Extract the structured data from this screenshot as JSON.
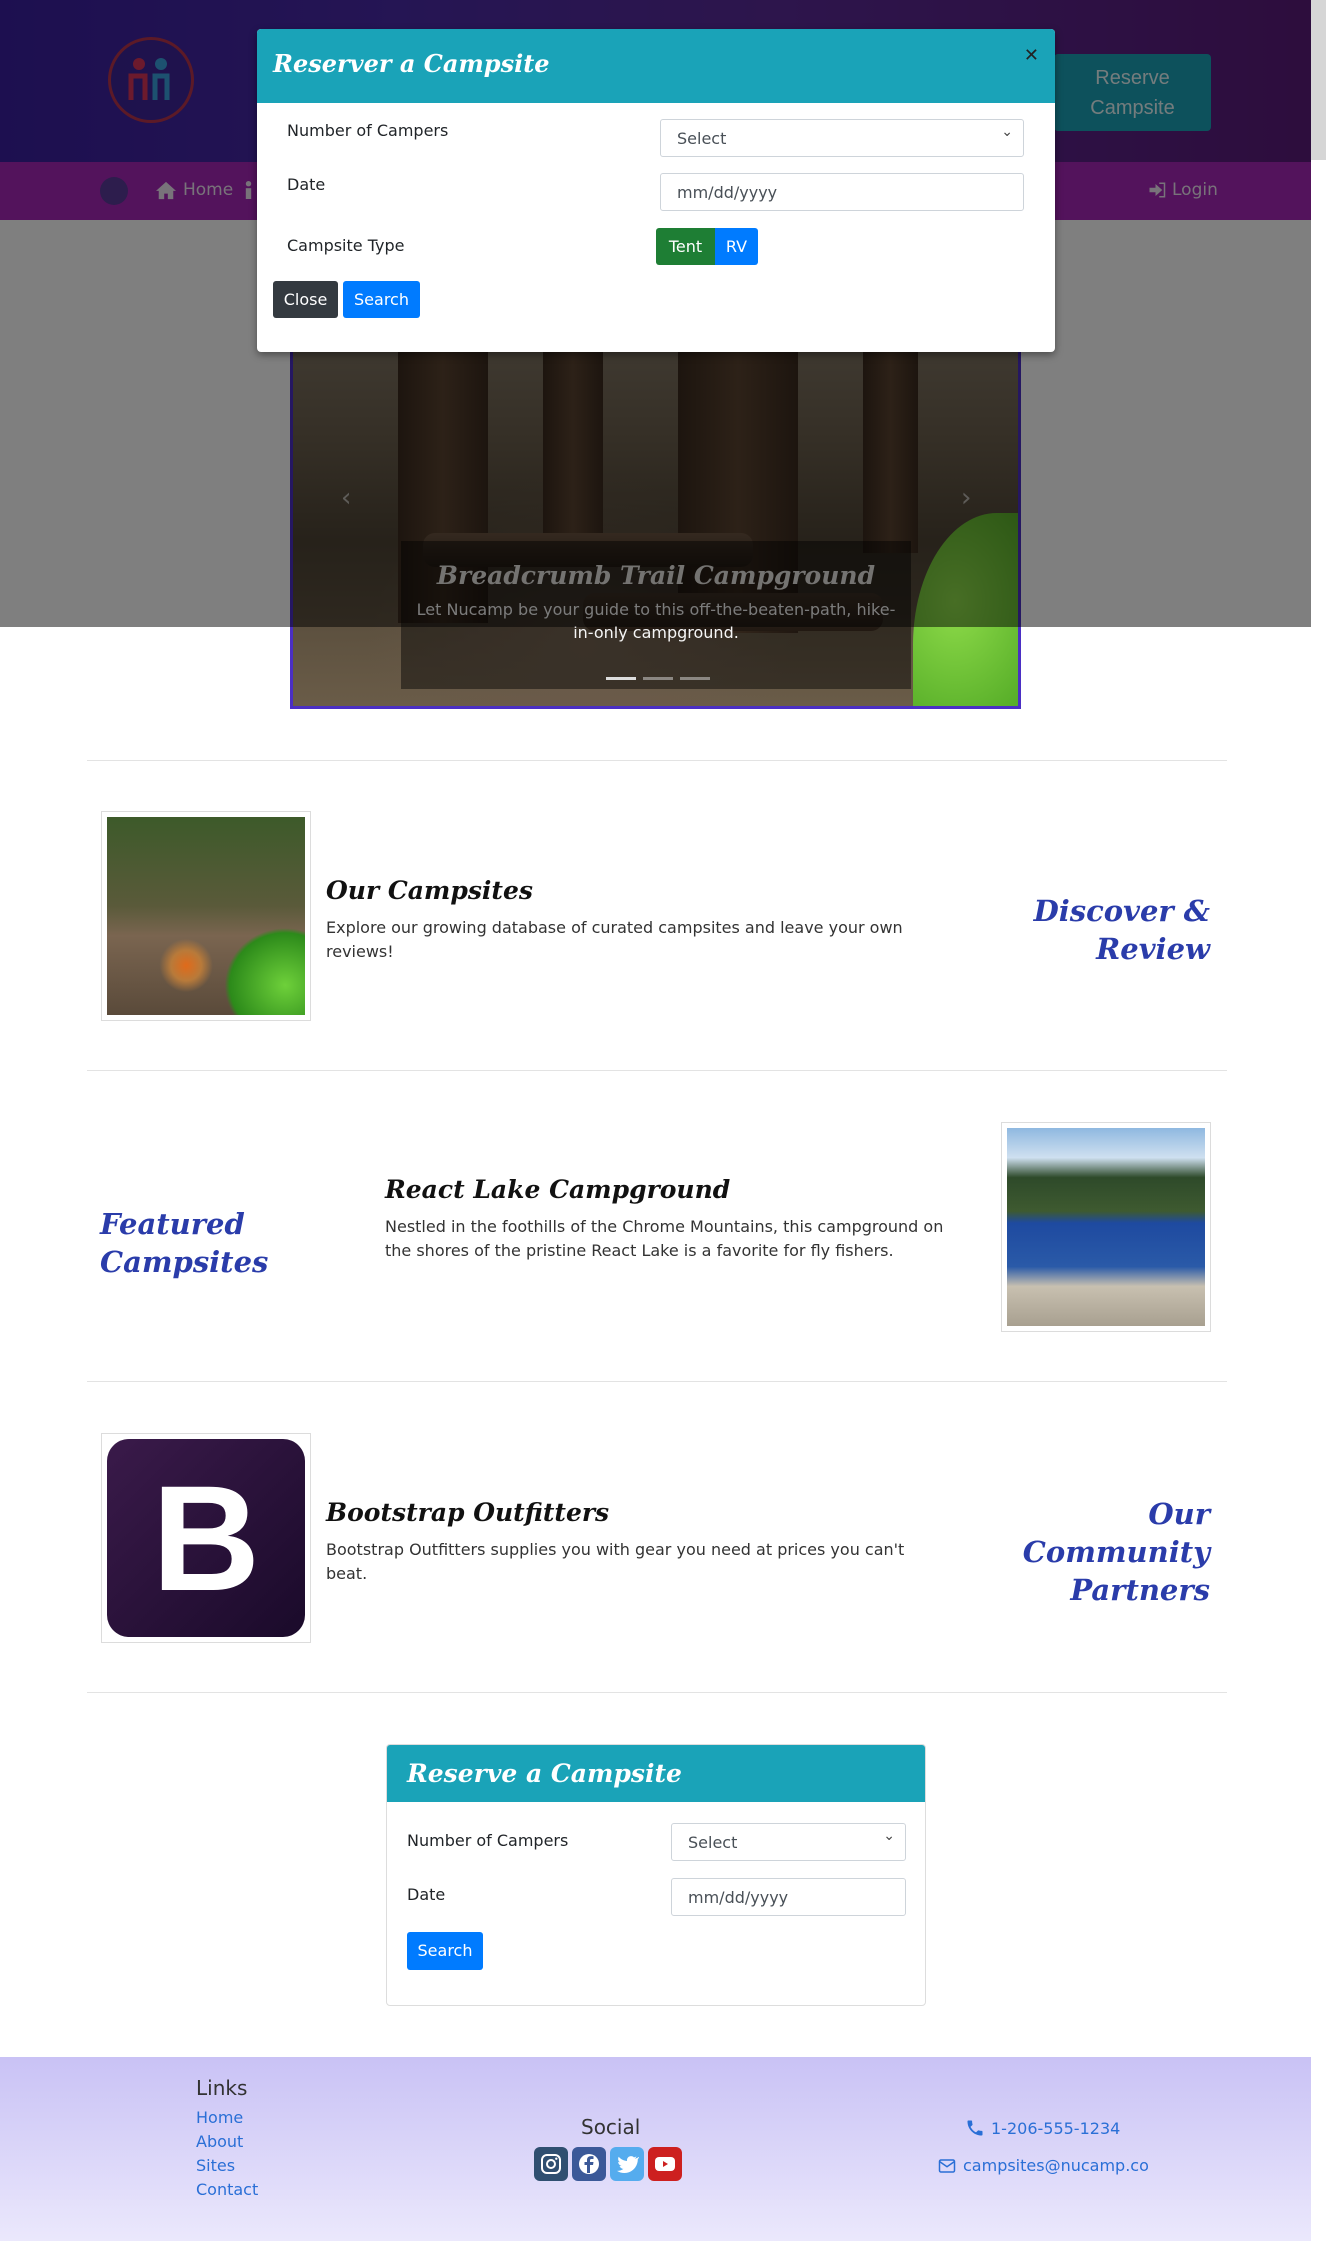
{
  "header": {
    "logo": "nucamp-logo-icon",
    "reserve_button": "Reserve Campsite"
  },
  "navbar": {
    "items": [
      {
        "label": "Home",
        "icon": "home-icon"
      },
      {
        "label": "Login",
        "icon": "sign-in-icon"
      }
    ]
  },
  "carousel": {
    "caption_title": "Breadcrumb Trail Campground",
    "caption_text": "Let Nucamp be your guide to this off-the-beaten-path, hike-in-only campground.",
    "indicators": 3,
    "active_indicator": 0
  },
  "modal": {
    "title": "Reserver a Campsite",
    "campers_label": "Number of Campers",
    "campers_value": "Select",
    "date_label": "Date",
    "date_placeholder": "mm/dd/yyyy",
    "type_label": "Campsite Type",
    "type_options": [
      "Tent",
      "RV"
    ],
    "type_selected": "Tent",
    "close_button": "Close",
    "search_button": "Search"
  },
  "sections": [
    {
      "title": "Our Campsites",
      "text": "Explore our growing database of curated campsites and leave your own reviews!",
      "side_heading": "Discover & Review"
    },
    {
      "title": "React Lake Campground",
      "text": "Nestled in the foothills of the Chrome Mountains, this campground on the shores of the pristine React Lake is a favorite for fly fishers.",
      "side_heading": "Featured Campsites"
    },
    {
      "title": "Bootstrap Outfitters",
      "text": "Bootstrap Outfitters supplies you with gear you need at prices you can't beat.",
      "side_heading": "Our Community Partners",
      "logo_letter": "B"
    }
  ],
  "reserve_card": {
    "title": "Reserve a Campsite",
    "campers_label": "Number of Campers",
    "campers_value": "Select",
    "date_label": "Date",
    "date_placeholder": "mm/dd/yyyy",
    "search_button": "Search"
  },
  "footer": {
    "links_heading": "Links",
    "links": [
      "Home",
      "About",
      "Sites",
      "Contact"
    ],
    "social_heading": "Social",
    "social_icons": [
      "instagram-icon",
      "facebook-icon",
      "twitter-icon",
      "youtube-icon"
    ],
    "phone": "1-206-555-1234",
    "email": "campsites@nucamp.co"
  },
  "colors": {
    "accent_teal": "#1aa3b8",
    "nav_purple": "#a626b8",
    "heading_blue": "#2a3caa",
    "primary_blue": "#007bff",
    "tent_green": "#1e7e34"
  }
}
